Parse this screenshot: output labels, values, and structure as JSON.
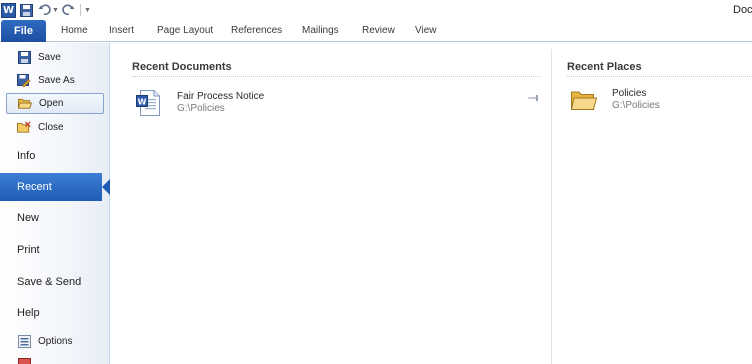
{
  "window": {
    "title": "Doc",
    "app_icon_letter": "W"
  },
  "quick_access": {
    "items": [
      "save-icon",
      "undo-icon",
      "redo-icon",
      "customize-icon"
    ]
  },
  "ribbon": {
    "file_tab": "File",
    "tabs": [
      "Home",
      "Insert",
      "Page Layout",
      "References",
      "Mailings",
      "Review",
      "View"
    ]
  },
  "backstage": {
    "commands": [
      {
        "label": "Save",
        "icon": "save-icon"
      },
      {
        "label": "Save As",
        "icon": "save-as-icon"
      },
      {
        "label": "Open",
        "icon": "open-folder-icon",
        "selected": true
      },
      {
        "label": "Close",
        "icon": "close-folder-icon"
      }
    ],
    "pages": [
      {
        "label": "Info"
      },
      {
        "label": "Recent",
        "active": true
      },
      {
        "label": "New"
      },
      {
        "label": "Print"
      },
      {
        "label": "Save & Send"
      },
      {
        "label": "Help"
      }
    ],
    "footer_commands": [
      {
        "label": "Options",
        "icon": "options-icon"
      }
    ]
  },
  "recent_documents": {
    "title": "Recent Documents",
    "items": [
      {
        "name": "Fair Process Notice",
        "path": "G:\\Policies",
        "icon": "word-document-icon",
        "pin_icon": "pin-icon"
      }
    ]
  },
  "recent_places": {
    "title": "Recent Places",
    "items": [
      {
        "name": "Policies",
        "path": "G:\\Policies",
        "icon": "folder-icon"
      }
    ]
  },
  "colors": {
    "accent": "#2a64bd",
    "nav_bg": "#eef2f8",
    "active_item": "#2a64bd"
  }
}
